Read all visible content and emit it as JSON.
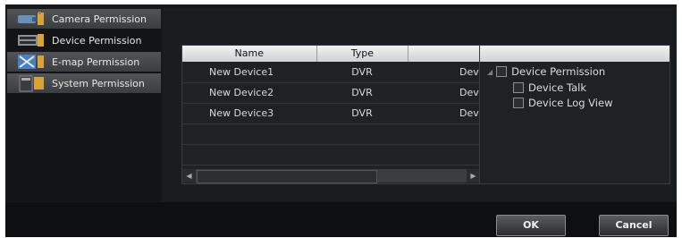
{
  "sidebar": {
    "items": [
      {
        "label": "Camera Permission",
        "icon": "camera-icon"
      },
      {
        "label": "Device Permission",
        "icon": "device-icon"
      },
      {
        "label": "E-map Permission",
        "icon": "emap-icon"
      },
      {
        "label": "System Permission",
        "icon": "system-icon"
      }
    ]
  },
  "table": {
    "columns": [
      "Name",
      "Type",
      ""
    ],
    "rows": [
      {
        "name": "New Device1",
        "type": "DVR",
        "extra": "Devic"
      },
      {
        "name": "New Device2",
        "type": "DVR",
        "extra": "Devic"
      },
      {
        "name": "New Device3",
        "type": "DVR",
        "extra": "Devic"
      }
    ]
  },
  "tree": {
    "root": "Device Permission",
    "children": [
      "Device Talk",
      "Device Log View"
    ]
  },
  "buttons": {
    "ok": "OK",
    "cancel": "Cancel"
  }
}
